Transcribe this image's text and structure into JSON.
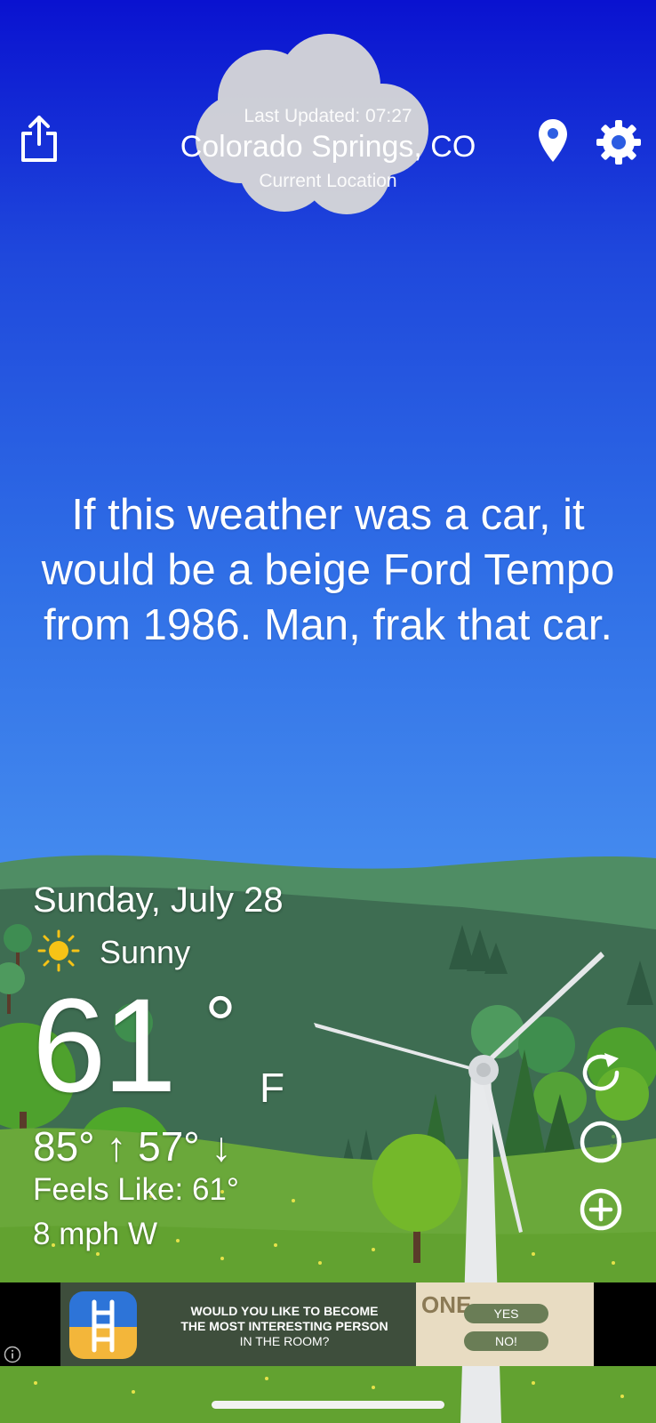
{
  "header": {
    "last_updated": "Last Updated: 07:27",
    "city": "Colorado Springs, CO",
    "location_label": "Current Location"
  },
  "quote": "If this weather was a car, it would be a beige Ford Tempo from 1986. Man, frak that car.",
  "weather": {
    "date": "Sunday, July 28",
    "condition": "Sunny",
    "temperature": "61",
    "degree_symbol": "°",
    "unit": "F",
    "high_low": "85° ↑ 57° ↓",
    "feels_like": "Feels Like: 61°",
    "wind": "8 mph W"
  },
  "icons": {
    "share": "share-icon",
    "location": "location-pin-icon",
    "settings": "gear-icon",
    "condition": "sun-icon",
    "refresh": "refresh-icon",
    "moon": "moon-icon",
    "add": "add-icon",
    "ad_info": "info-icon"
  },
  "ad": {
    "line1": "WOULD YOU LIKE TO BECOME",
    "line2": "THE MOST INTERESTING PERSON",
    "line3": "IN THE ROOM?",
    "image_title": "ONE",
    "yes_label": "YES",
    "no_label": "NO!"
  },
  "colors": {
    "sky_top": "#0a12d0",
    "sky_bottom": "#56a5f6",
    "hills_far": "#3f6e55",
    "grass": "#6aa83a",
    "tree_green": "#74b82a",
    "sun": "#f6c316"
  }
}
